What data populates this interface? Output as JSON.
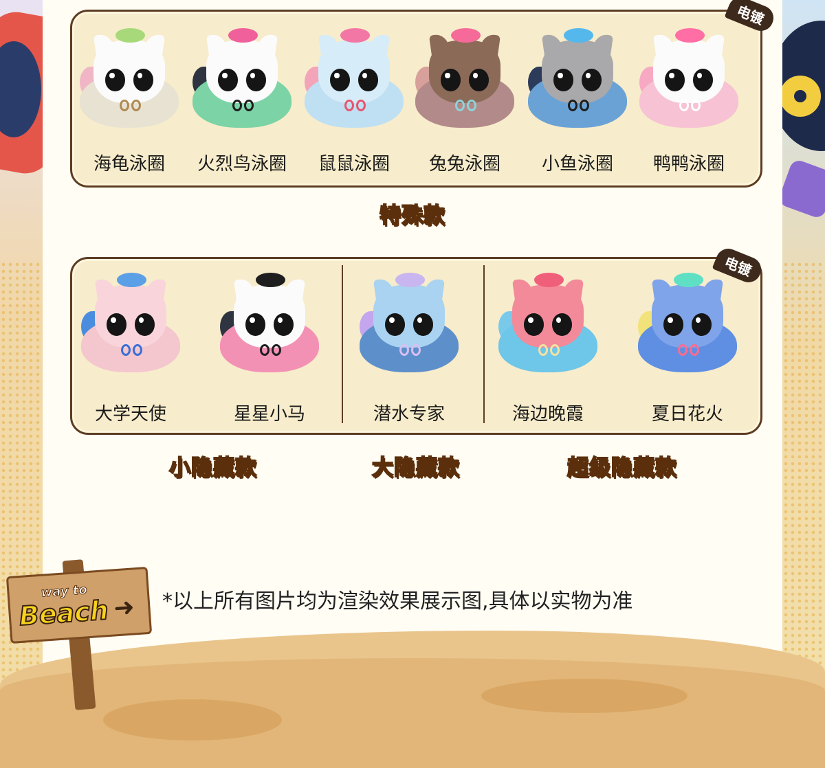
{
  "badges": {
    "top": "电镀",
    "bottom": "电镀"
  },
  "row1": {
    "items": [
      {
        "label": "海龟泳圈",
        "head": "#fbfbfb",
        "body": "#e8e2d2",
        "hat": "#a7d97a",
        "bow": "#b08a52",
        "wing": "#f0b6c5"
      },
      {
        "label": "火烈鸟泳圈",
        "head": "#fbfbfb",
        "body": "#7cd3a6",
        "hat": "#f0609a",
        "bow": "#1e1e1e",
        "wing": "#2e3440"
      },
      {
        "label": "鼠鼠泳圈",
        "head": "#d6ecf8",
        "body": "#bfe0f2",
        "hat": "#f377a5",
        "bow": "#e7556f",
        "wing": "#f3a4b8"
      },
      {
        "label": "兔兔泳圈",
        "head": "#8c6a58",
        "body": "#b28a8a",
        "hat": "#f56a98",
        "bow": "#8ed3d8",
        "wing": "#d7a09a"
      },
      {
        "label": "小鱼泳圈",
        "head": "#a9a9ab",
        "body": "#6aa2d6",
        "hat": "#55b8ec",
        "bow": "#1e1e1e",
        "wing": "#2d3b5a"
      },
      {
        "label": "鸭鸭泳圈",
        "head": "#fbfbfb",
        "body": "#f7c2d4",
        "hat": "#ff6ea4",
        "bow": "#ffffff",
        "wing": "#f7a9c3"
      }
    ]
  },
  "row2": {
    "items": [
      {
        "label": "大学天使",
        "head": "#f9d5db",
        "body": "#f4c6ce",
        "hat": "#5b9fe6",
        "bow": "#3b6fd6",
        "wing": "#4a8dde"
      },
      {
        "label": "星星小马",
        "head": "#fbfbfb",
        "body": "#f391b5",
        "hat": "#1e1e1e",
        "bow": "#1e1e1e",
        "wing": "#2e3440"
      },
      {
        "label": "潜水专家",
        "head": "#a9d3f0",
        "body": "#5d8fcb",
        "hat": "#c9b5ef",
        "bow": "#d8c0f2",
        "wing": "#c3a6ee"
      },
      {
        "label": "海边晚霞",
        "head": "#f28a9a",
        "body": "#6ec6e8",
        "hat": "#f05f7a",
        "bow": "#f4e1a4",
        "wing": "#78c9ea"
      },
      {
        "label": "夏日花火",
        "head": "#7fa4ea",
        "body": "#5e8fe2",
        "hat": "#5fe0c5",
        "bow": "#ff6b8e",
        "wing": "#f1e27a"
      }
    ]
  },
  "titles": {
    "special": "特殊款",
    "small_hidden": "小隐藏款",
    "big_hidden": "大隐藏款",
    "super_hidden": "超级隐藏款"
  },
  "note": "*以上所有图片均为渲染效果展示图,具体以实物为准",
  "sign": {
    "line1": "way to",
    "line2": "Beach"
  }
}
